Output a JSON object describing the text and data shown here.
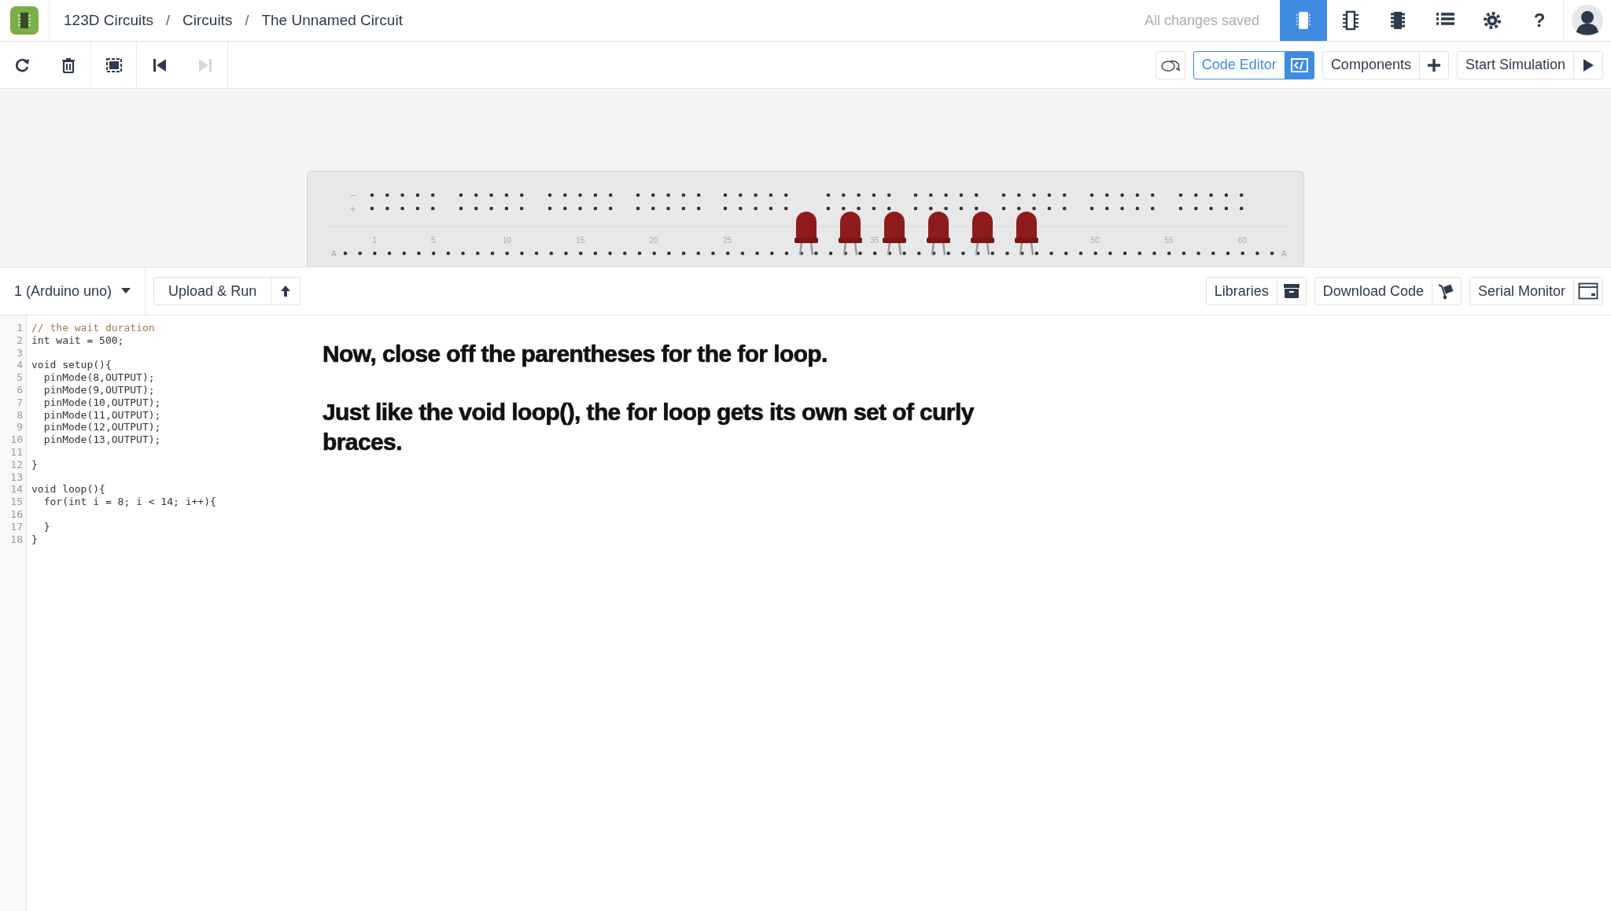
{
  "header": {
    "breadcrumbs": [
      {
        "kind": "link",
        "label": "123D Circuits"
      },
      {
        "kind": "separator",
        "label": "/"
      },
      {
        "kind": "link",
        "label": "Circuits"
      },
      {
        "kind": "separator",
        "label": "/"
      },
      {
        "kind": "link",
        "label": "The Unnamed Circuit"
      }
    ],
    "save_status": "All changes saved",
    "views": [
      {
        "kind": "breadboard",
        "selected": true
      },
      {
        "kind": "schematic",
        "selected": false
      },
      {
        "kind": "pcb",
        "selected": false
      },
      {
        "kind": "list",
        "selected": false
      }
    ],
    "help_label": "?"
  },
  "toolbar": {
    "tools": [
      {
        "kind": "rotate",
        "disabled": false
      },
      {
        "kind": "delete",
        "disabled": false
      },
      {
        "kind": "fit",
        "disabled": false
      },
      {
        "kind": "step_back",
        "disabled": false
      },
      {
        "kind": "step_forward",
        "disabled": true
      }
    ],
    "actions": [
      {
        "kind": "notes",
        "active": false
      },
      {
        "kind": "code",
        "label": "Code Editor",
        "active": true
      },
      {
        "kind": "components",
        "label": "Components",
        "active": false
      },
      {
        "kind": "simulate",
        "label": "Start Simulation",
        "active": false
      }
    ]
  },
  "breadboard": {
    "rail_labels": [
      "−",
      "+"
    ],
    "row_label_left": "A",
    "row_label_right": "A",
    "column_labels": [
      "1",
      "5",
      "10",
      "15",
      "20",
      "25",
      "35",
      "50",
      "55",
      "60"
    ]
  },
  "code_panel": {
    "board": "1 (Arduino uno)",
    "upload_button": "Upload & Run",
    "tools": [
      {
        "kind": "libraries",
        "label": "Libraries"
      },
      {
        "kind": "download",
        "label": "Download Code"
      },
      {
        "kind": "serial",
        "label": "Serial Monitor"
      }
    ],
    "lines": [
      {
        "number": "1",
        "kind": "comment",
        "text": "// the wait duration"
      },
      {
        "number": "2",
        "kind": "code",
        "text": "int wait = 500;"
      },
      {
        "number": "3"
      },
      {
        "number": "4",
        "kind": "code",
        "text": "void setup(){"
      },
      {
        "number": "5",
        "kind": "code",
        "text": "  pinMode(8,OUTPUT);"
      },
      {
        "number": "6",
        "kind": "code",
        "text": "  pinMode(9,OUTPUT);"
      },
      {
        "number": "7",
        "kind": "code",
        "text": "  pinMode(10,OUTPUT);"
      },
      {
        "number": "8",
        "kind": "code",
        "text": "  pinMode(11,OUTPUT);"
      },
      {
        "number": "9",
        "kind": "code",
        "text": "  pinMode(12,OUTPUT);"
      },
      {
        "number": "10",
        "kind": "code",
        "text": "  pinMode(13,OUTPUT);"
      },
      {
        "number": "11"
      },
      {
        "number": "12",
        "kind": "code",
        "text": "}"
      },
      {
        "number": "13"
      },
      {
        "number": "14",
        "kind": "code",
        "text": "void loop(){"
      },
      {
        "number": "15",
        "kind": "code",
        "text": "  for(int i = 8; i < 14; i++){"
      },
      {
        "number": "16"
      },
      {
        "number": "17",
        "kind": "code",
        "text": "  }"
      },
      {
        "number": "18",
        "kind": "code",
        "text": "}"
      }
    ]
  },
  "instructions": [
    "Now, close off the parentheses for the for loop.",
    "Just like the void loop(), the for loop gets its own set of curly braces."
  ]
}
